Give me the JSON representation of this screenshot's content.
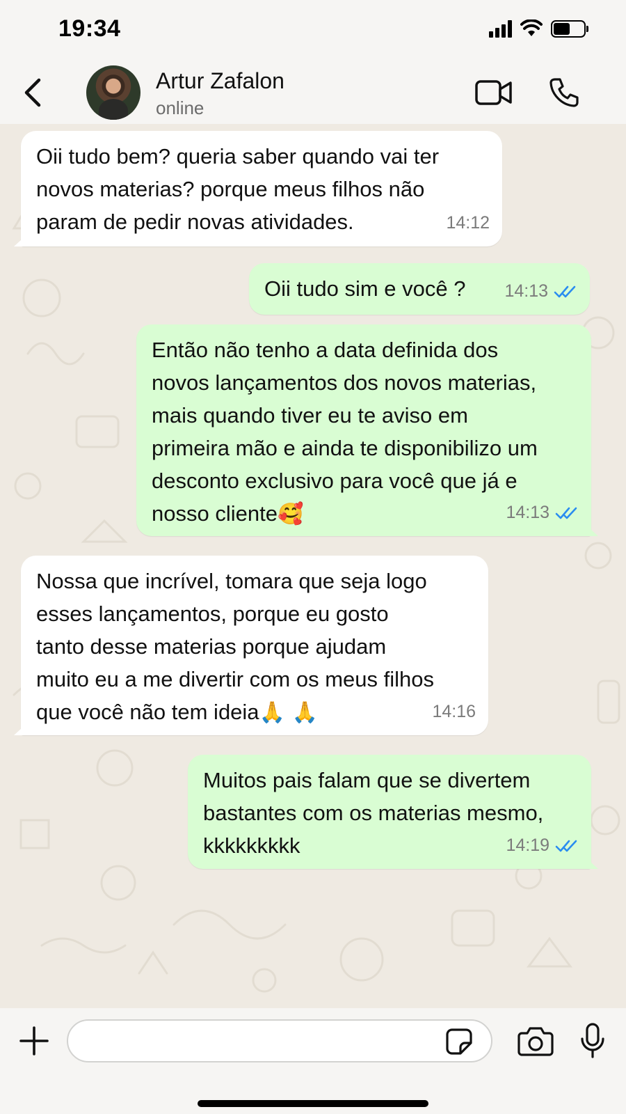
{
  "status_bar": {
    "time": "19:34",
    "icons": [
      "cellular-signal-icon",
      "wifi-icon",
      "battery-icon"
    ],
    "battery_level": 0.55
  },
  "header": {
    "contact_name": "Artur Zafalon",
    "contact_status": "online",
    "icons": [
      "back-chevron-icon",
      "avatar",
      "video-camera-icon",
      "phone-icon"
    ]
  },
  "messages": [
    {
      "direction": "incoming",
      "text": "Oii tudo bem? queria saber quando vai ter\nnovos materias? porque meus filhos não\nparam de pedir novas atividades.",
      "time": "14:12"
    },
    {
      "direction": "outgoing",
      "text": "Oii tudo sim e você ?",
      "time": "14:13",
      "read": true
    },
    {
      "direction": "outgoing",
      "text": "Então não tenho a data definida dos\nnovos lançamentos dos novos materias,\nmais quando tiver eu te aviso em\nprimeira mão e ainda te disponibilizo um\ndesconto exclusivo para você que já e\nnosso cliente",
      "emoji": "🥰",
      "time": "14:13",
      "read": true
    },
    {
      "direction": "incoming",
      "text": "Nossa que incrível, tomara que seja logo\nesses lançamentos, porque eu gosto\ntanto desse materias porque ajudam\nmuito eu a me divertir com os meus filhos\nque você não tem ideia",
      "emoji": "🙏 🙏",
      "time": "14:16"
    },
    {
      "direction": "outgoing",
      "text": "Muitos pais falam que se divertem\nbastantes com os materias mesmo,\nkkkkkkkkk",
      "time": "14:19",
      "read": true
    }
  ],
  "composer": {
    "value": "",
    "placeholder": "",
    "icons": [
      "plus-icon",
      "sticker-icon",
      "camera-icon",
      "microphone-icon"
    ]
  },
  "colors": {
    "incoming_bubble": "#ffffff",
    "outgoing_bubble": "#d9fdd3",
    "read_ticks": "#2a8cf0",
    "chat_background": "#efeae2",
    "timestamp": "#7b7b7b"
  }
}
